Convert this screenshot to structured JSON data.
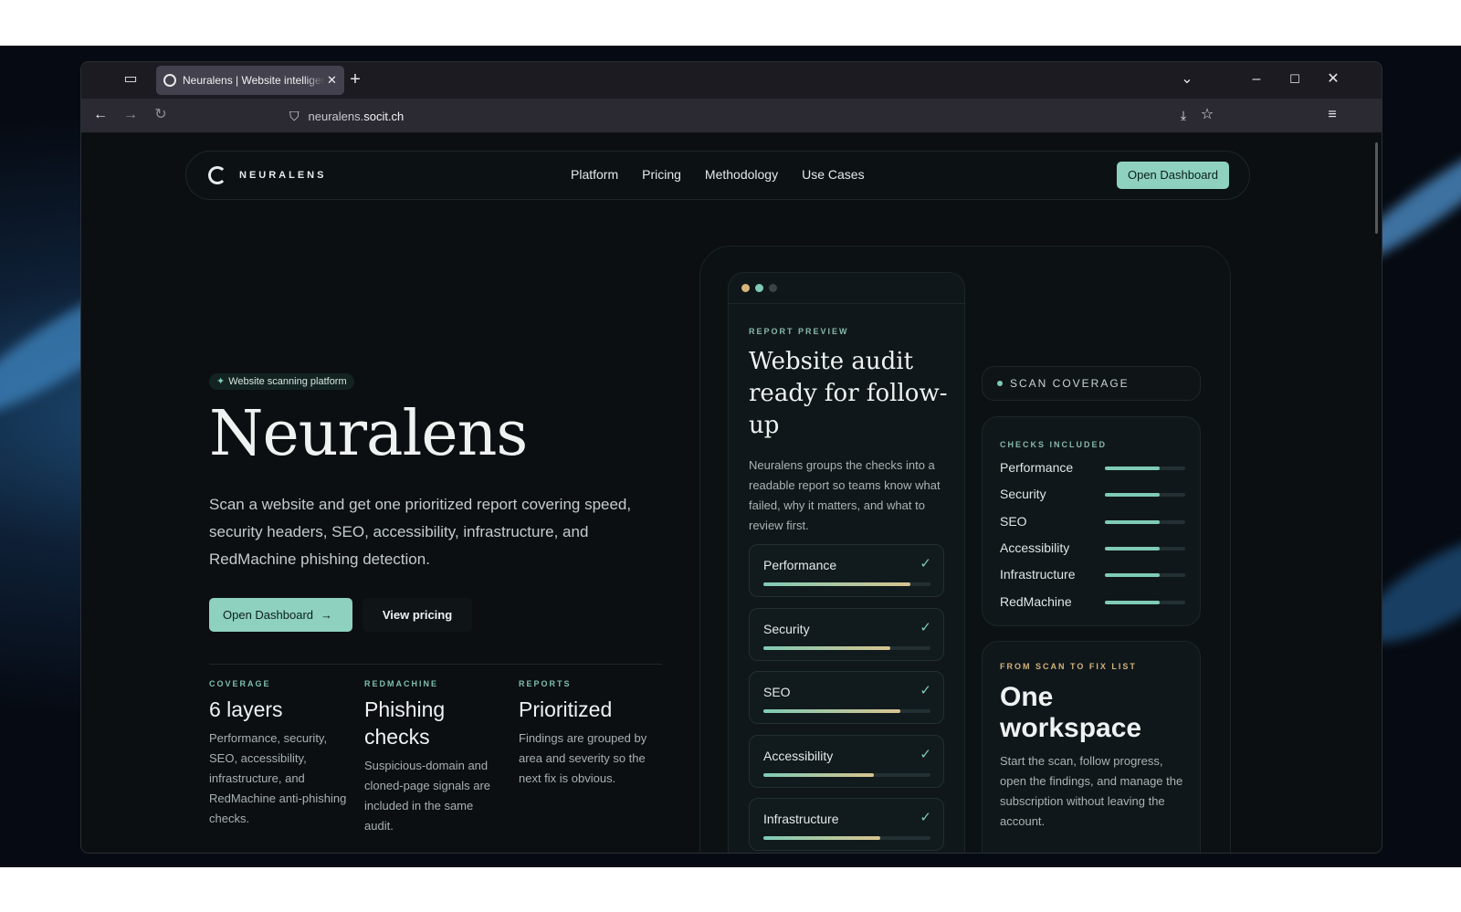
{
  "browser": {
    "tab_title": "Neuralens | Website intelligence",
    "url_prefix": "neuralens.",
    "url_domain": "socit.ch",
    "new_tab_symbol": "+",
    "close_symbol": "✕"
  },
  "nav": {
    "brand": "NEURALENS",
    "links": [
      "Platform",
      "Pricing",
      "Methodology",
      "Use Cases"
    ],
    "cta": "Open Dashboard"
  },
  "hero": {
    "badge": "Website scanning platform",
    "title": "Neuralens",
    "description": "Scan a website and get one prioritized report covering speed, security headers, SEO, accessibility, infrastructure, and RedMachine phishing detection.",
    "primary_button": "Open Dashboard",
    "secondary_button": "View pricing"
  },
  "stats": [
    {
      "label": "COVERAGE",
      "value": "6 layers",
      "text": "Performance, security, SEO, accessibility, infrastructure, and RedMachine anti-phishing checks."
    },
    {
      "label": "REDMACHINE",
      "value": "Phishing checks",
      "text": "Suspicious-domain and cloned-page signals are included in the same audit."
    },
    {
      "label": "REPORTS",
      "value": "Prioritized",
      "text": "Findings are grouped by area and severity so the next fix is obvious."
    }
  ],
  "report": {
    "eyebrow": "REPORT PREVIEW",
    "title": "Website audit ready for follow-up",
    "description": "Neuralens groups the checks into a readable report so teams know what failed, why it matters, and what to review first.",
    "checks": [
      {
        "name": "Performance",
        "progress": 0.88
      },
      {
        "name": "Security",
        "progress": 0.76
      },
      {
        "name": "SEO",
        "progress": 0.82
      },
      {
        "name": "Accessibility",
        "progress": 0.66
      },
      {
        "name": "Infrastructure",
        "progress": 0.7
      }
    ]
  },
  "coverage": {
    "label": "SCAN COVERAGE",
    "checks_label": "CHECKS INCLUDED",
    "items": [
      {
        "name": "Performance",
        "progress": 0.68
      },
      {
        "name": "Security",
        "progress": 0.68
      },
      {
        "name": "SEO",
        "progress": 0.68
      },
      {
        "name": "Accessibility",
        "progress": 0.68
      },
      {
        "name": "Infrastructure",
        "progress": 0.68
      },
      {
        "name": "RedMachine",
        "progress": 0.68
      }
    ]
  },
  "workspace": {
    "eyebrow": "FROM SCAN TO FIX LIST",
    "title": "One workspace",
    "description": "Start the scan, follow progress, open the findings, and manage the subscription without leaving the account."
  },
  "colors": {
    "accent": "#8fd1bf",
    "background": "#0b0f11",
    "gold": "#d2b27b"
  }
}
